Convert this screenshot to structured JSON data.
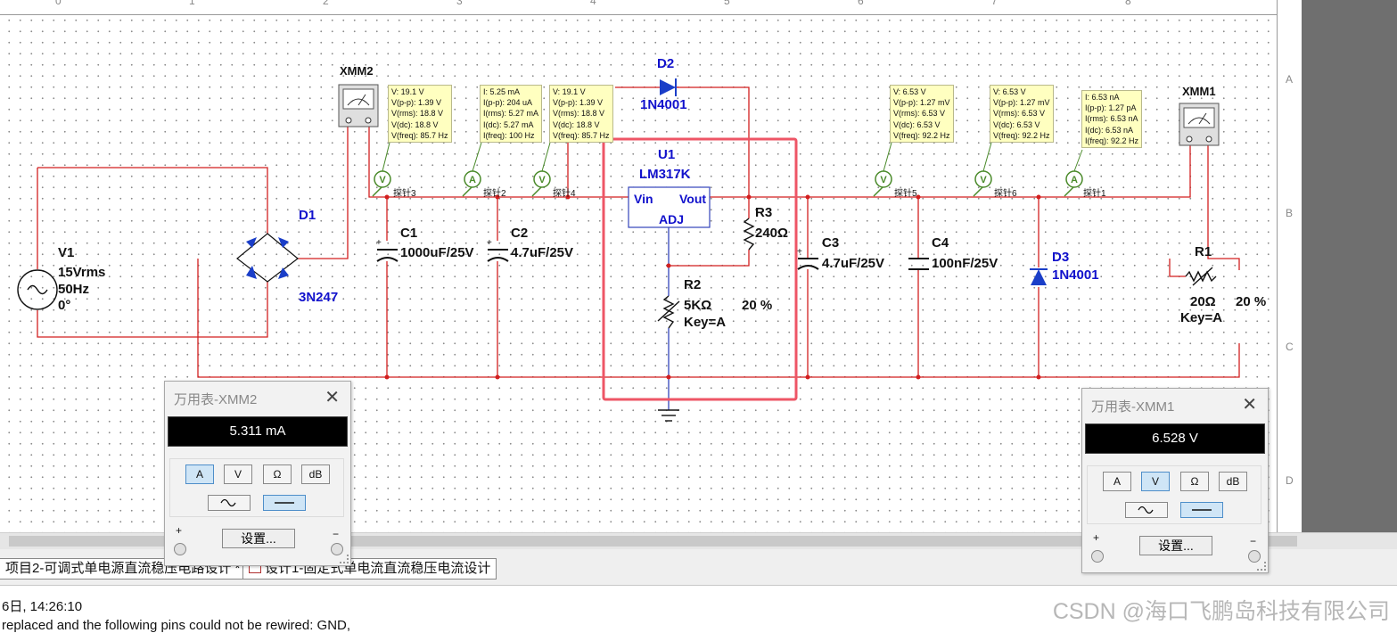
{
  "rulers": {
    "top": [
      "0",
      "1",
      "2",
      "3",
      "4",
      "5",
      "6",
      "7",
      "8"
    ],
    "right": [
      "A",
      "B",
      "C",
      "D"
    ]
  },
  "probes": [
    {
      "name": "probe-box-1",
      "lines": [
        "V: 19.1 V",
        "V(p-p): 1.39 V",
        "V(rms): 18.8 V",
        "V(dc): 18.8 V",
        "V(freq): 85.7 Hz"
      ]
    },
    {
      "name": "probe-box-2",
      "lines": [
        "I: 5.25 mA",
        "I(p-p): 204 uA",
        "I(rms): 5.27 mA",
        "I(dc): 5.27 mA",
        "I(freq): 100 Hz"
      ]
    },
    {
      "name": "probe-box-3",
      "lines": [
        "V: 19.1 V",
        "V(p-p): 1.39 V",
        "V(rms): 18.8 V",
        "V(dc): 18.8 V",
        "V(freq): 85.7 Hz"
      ]
    },
    {
      "name": "probe-box-4",
      "lines": [
        "V: 6.53 V",
        "V(p-p): 1.27 mV",
        "V(rms): 6.53 V",
        "V(dc): 6.53 V",
        "V(freq): 92.2 Hz"
      ]
    },
    {
      "name": "probe-box-5",
      "lines": [
        "V: 6.53 V",
        "V(p-p): 1.27 mV",
        "V(rms): 6.53 V",
        "V(dc): 6.53 V",
        "V(freq): 92.2 Hz"
      ]
    },
    {
      "name": "probe-box-6",
      "lines": [
        "I: 6.53 nA",
        "I(p-p): 1.27 pA",
        "I(rms): 6.53 nA",
        "I(dc): 6.53 nA",
        "I(freq): 92.2 Hz"
      ]
    }
  ],
  "probe_tags": [
    "探针3",
    "探针2",
    "探针4",
    "探针5",
    "探针6",
    "探针1"
  ],
  "probe_symbols": {
    "voltage": "V",
    "current": "A"
  },
  "components": {
    "xmm2": "XMM2",
    "xmm1": "XMM1",
    "d2": {
      "ref": "D2",
      "model": "1N4001"
    },
    "d1": {
      "ref": "D1",
      "model": "3N247"
    },
    "v1": {
      "ref": "V1",
      "value": "15Vrms",
      "freq": "50Hz",
      "phase": "0°"
    },
    "c1": {
      "ref": "C1",
      "value": "1000uF/25V"
    },
    "c2": {
      "ref": "C2",
      "value": "4.7uF/25V"
    },
    "u1": {
      "ref": "U1",
      "model": "LM317K",
      "vin": "Vin",
      "vout": "Vout",
      "adj": "ADJ"
    },
    "r3": {
      "ref": "R3",
      "value": "240Ω"
    },
    "r2": {
      "ref": "R2",
      "value": "5KΩ",
      "percent": "20 %",
      "key": "Key=A"
    },
    "c3": {
      "ref": "C3",
      "value": "4.7uF/25V"
    },
    "c4": {
      "ref": "C4",
      "value": "100nF/25V"
    },
    "d3": {
      "ref": "D3",
      "model": "1N4001"
    },
    "r1": {
      "ref": "R1",
      "value": "20Ω",
      "percent": "20 %",
      "key": "Key=A"
    }
  },
  "multimeters": [
    {
      "title": "万用表-XMM2",
      "reading": "5.311 mA",
      "mode_active": "A",
      "coupling": "DC",
      "buttons": [
        "A",
        "V",
        "Ω",
        "dB"
      ],
      "settings_label": "设置...",
      "plus": "+",
      "minus": "−"
    },
    {
      "title": "万用表-XMM1",
      "reading": "6.528 V",
      "mode_active": "V",
      "coupling": "DC",
      "buttons": [
        "A",
        "V",
        "Ω",
        "dB"
      ],
      "settings_label": "设置...",
      "plus": "+",
      "minus": "−"
    }
  ],
  "tabs": [
    "项目2-可调式单电源直流稳压电路设计 *",
    "设计1-固定式单电流直流稳压电流设计"
  ],
  "output_lines": [
    "6日, 14:26:10",
    "replaced and the following pins could not be rewired: GND,"
  ],
  "watermark": "CSDN @海口飞鹏岛科技有限公司",
  "colors": {
    "wire": "#d21f1f",
    "component": "#111111",
    "label_blue": "#1111cc",
    "highlight": "#ee5566",
    "probe_bg": "#ffffc0",
    "probe_symbol": "#4a8a2a"
  }
}
